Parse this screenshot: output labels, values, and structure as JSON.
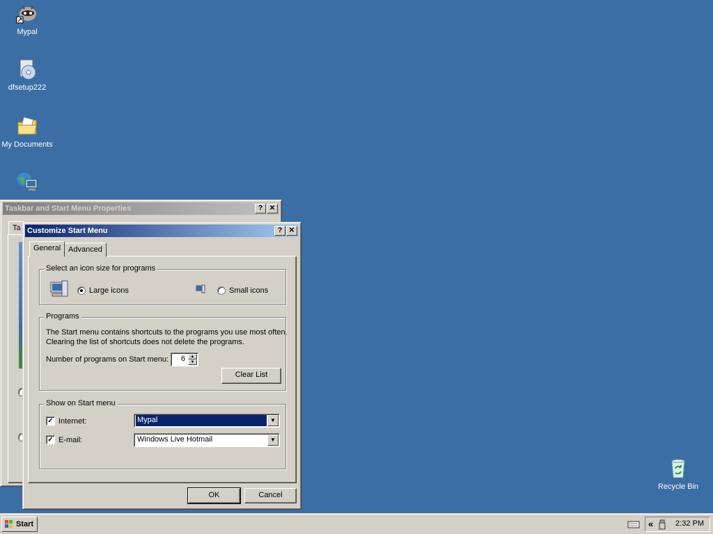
{
  "desktop": {
    "icons": [
      {
        "label": "Mypal",
        "icon": "mypal-raccoon-icon"
      },
      {
        "label": "dfsetup222",
        "icon": "setup-cd-icon"
      },
      {
        "label": "My Documents",
        "icon": "folder-icon"
      },
      {
        "label": "",
        "icon": "network-computer-icon"
      },
      {
        "label": "Recycle Bin",
        "icon": "recycle-bin-icon"
      }
    ]
  },
  "taskbar_props_window": {
    "title": "Taskbar and Start Menu Properties",
    "tab_partial": "Ta"
  },
  "customize_dialog": {
    "title": "Customize Start Menu",
    "tabs": [
      "General",
      "Advanced"
    ],
    "active_tab": "General",
    "icon_size_group": {
      "title": "Select an icon size for programs",
      "large_label": "Large icons",
      "small_label": "Small icons",
      "selected": "Large icons"
    },
    "programs_group": {
      "title": "Programs",
      "description_line1": "The Start menu contains shortcuts to the programs you use most often.",
      "description_line2": "Clearing the list of shortcuts does not delete the programs.",
      "count_label": "Number of programs on Start menu:",
      "count_value": "6",
      "clear_button": "Clear List"
    },
    "show_group": {
      "title": "Show on Start menu",
      "internet_label": "Internet:",
      "internet_checked": true,
      "internet_value": "Mypal",
      "email_label": "E-mail:",
      "email_checked": true,
      "email_value": "Windows Live Hotmail"
    },
    "ok_button": "OK",
    "cancel_button": "Cancel"
  },
  "taskbar": {
    "start_label": "Start",
    "clock": "2:32 PM",
    "tray_expand": "«"
  },
  "colors": {
    "desktop": "#3a6ea5",
    "title_active": "#0a246a",
    "face": "#d4d0c8"
  }
}
